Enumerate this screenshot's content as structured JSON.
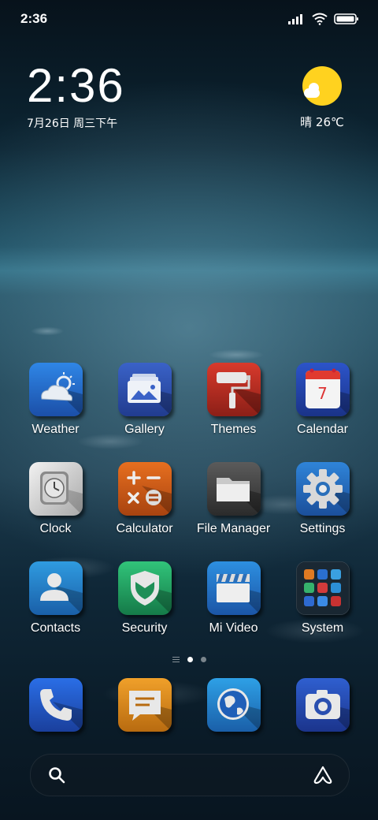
{
  "status_bar": {
    "time": "2:36",
    "icons": [
      "signal-icon",
      "wifi-icon",
      "battery-icon"
    ]
  },
  "clock_widget": {
    "time": "2:36",
    "date": "7月26日 周三下午"
  },
  "weather_widget": {
    "icon": "sunny-partly-cloudy-icon",
    "text": "晴 26℃"
  },
  "apps": [
    {
      "label": "Weather",
      "icon": "weather-icon"
    },
    {
      "label": "Gallery",
      "icon": "gallery-icon"
    },
    {
      "label": "Themes",
      "icon": "themes-icon"
    },
    {
      "label": "Calendar",
      "icon": "calendar-icon",
      "badge": "7"
    },
    {
      "label": "Clock",
      "icon": "clock-icon"
    },
    {
      "label": "Calculator",
      "icon": "calculator-icon"
    },
    {
      "label": "File Manager",
      "icon": "file-manager-icon"
    },
    {
      "label": "Settings",
      "icon": "settings-icon"
    },
    {
      "label": "Contacts",
      "icon": "contacts-icon"
    },
    {
      "label": "Security",
      "icon": "security-icon"
    },
    {
      "label": "Mi Video",
      "icon": "mi-video-icon"
    },
    {
      "label": "System",
      "icon": "folder-icon"
    }
  ],
  "page_indicator": {
    "pages": 2,
    "active": 1
  },
  "dock": [
    {
      "icon": "phone-icon"
    },
    {
      "icon": "messages-icon"
    },
    {
      "icon": "browser-icon"
    },
    {
      "icon": "camera-icon"
    }
  ],
  "search_bar": {
    "icon": "search-icon",
    "assistant_icon": "assistant-icon"
  },
  "colors": {
    "sun": "#ffd21f",
    "calendar_red": "#e03a2f"
  }
}
